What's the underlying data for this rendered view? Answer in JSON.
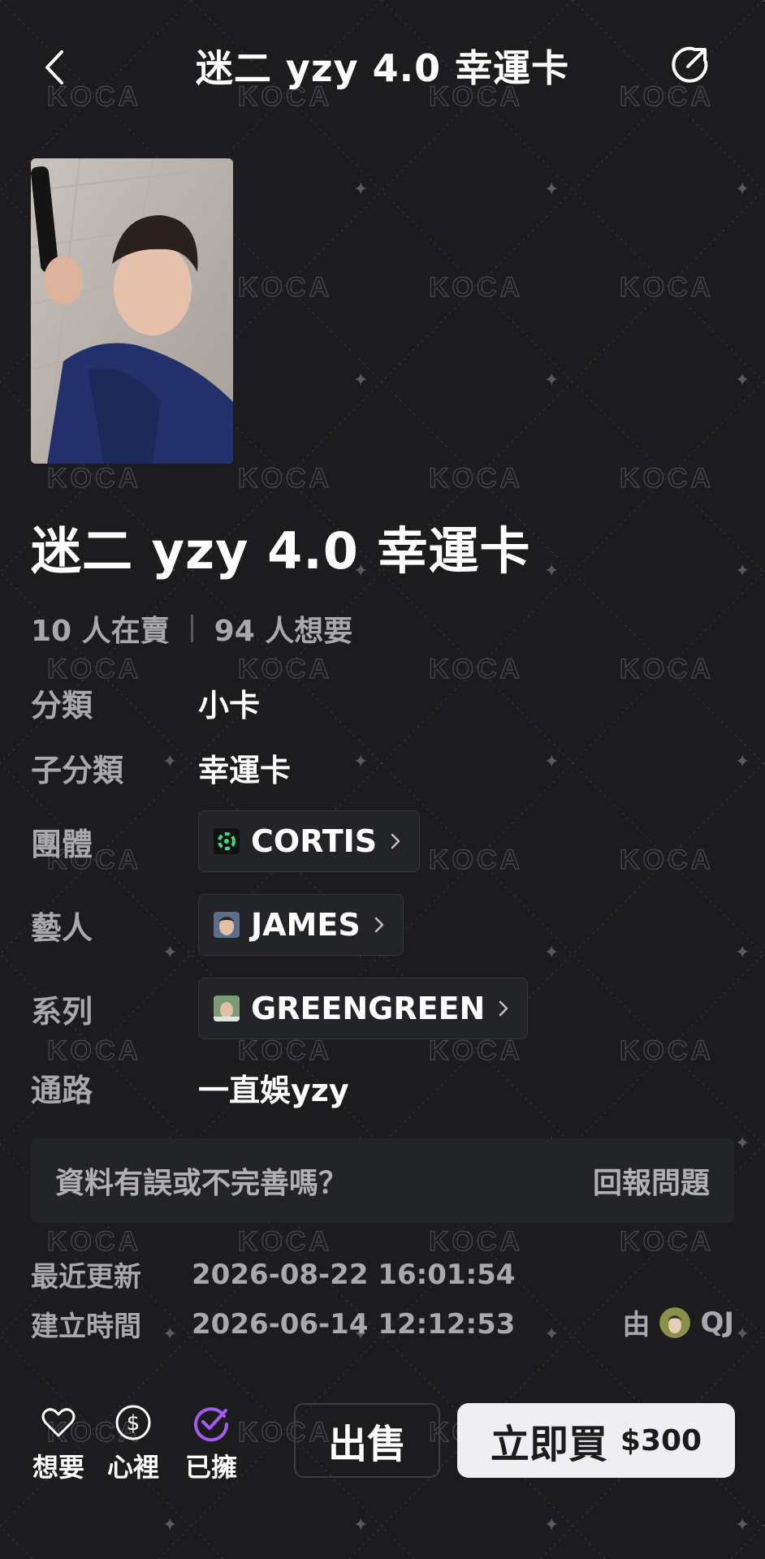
{
  "header": {
    "title": "迷二 yzy 4.0 幸運卡"
  },
  "watermark_text": "KOCA",
  "product": {
    "title": "迷二 yzy 4.0 幸運卡",
    "selling_count": "10 人在賣",
    "wanting_count": "94 人想要"
  },
  "details": {
    "category_label": "分類",
    "category_value": "小卡",
    "subcategory_label": "子分類",
    "subcategory_value": "幸運卡",
    "group_label": "團體",
    "group_value": "CORTIS",
    "artist_label": "藝人",
    "artist_value": "JAMES",
    "series_label": "系列",
    "series_value": "GREENGREEN",
    "channel_label": "通路",
    "channel_value": "一直娛yzy"
  },
  "report": {
    "question": "資料有誤或不完善嗎？",
    "link": "回報問題"
  },
  "meta": {
    "updated_label": "最近更新",
    "updated_value": "2026-08-22 16:01:54",
    "created_label": "建立時間",
    "created_value": "2026-06-14 12:12:53",
    "by_label": "由",
    "creator_name": "QJ"
  },
  "bottom": {
    "want_label": "想要",
    "heart_label": "心裡",
    "own_label": "已擁",
    "sell_label": "出售",
    "buy_label": "立即買",
    "buy_price": "$300"
  },
  "colors": {
    "background": "#1c1c1e",
    "accent_purple": "#a45cf0",
    "muted_text": "#a8a8ae",
    "buy_button_bg": "#efeff1"
  }
}
